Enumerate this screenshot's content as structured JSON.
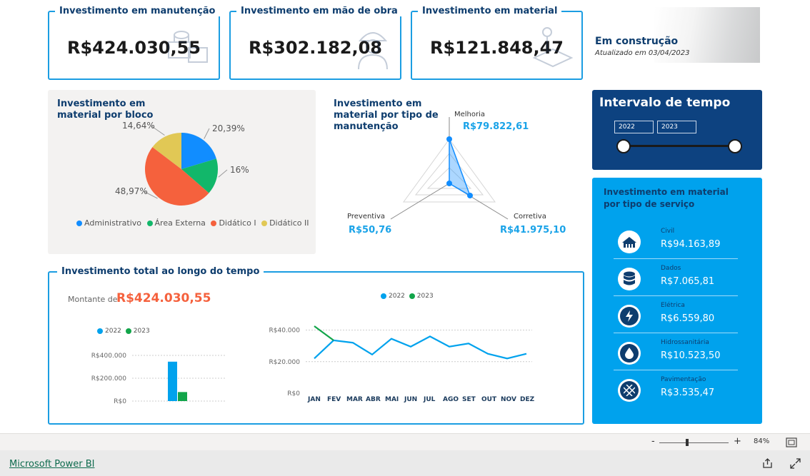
{
  "kpis": [
    {
      "title": "Investimento em manutenção",
      "value": "R$424.030,55",
      "icon": "building-materials-icon"
    },
    {
      "title": "Investimento em mão de obra",
      "value": "R$302.182,08",
      "icon": "construction-worker-icon"
    },
    {
      "title": "Investimento em material",
      "value": "R$121.848,47",
      "icon": "crane-materials-icon"
    }
  ],
  "header": {
    "status": "Em construção",
    "updated": "Atualizado em 03/04/2023"
  },
  "pie": {
    "title_line1": "Investimento em",
    "title_line2": "material por bloco",
    "labels": [
      "20,39%",
      "16%",
      "48,97%",
      "14,64%"
    ],
    "legend": [
      "Administrativo",
      "Área Externa",
      "Didático I",
      "Didático II"
    ],
    "colors": [
      "#118dff",
      "#12b76a",
      "#f5613d",
      "#e1c855"
    ]
  },
  "radar": {
    "title_line1": "Investimento em",
    "title_line2": "material por tipo de",
    "title_line3": "manutenção",
    "top_label": "Melhoria",
    "top_value": "R$79.822,61",
    "left_label": "Preventiva",
    "left_value": "R$50,76",
    "right_label": "Corretiva",
    "right_value": "R$41.975,10"
  },
  "timerange": {
    "title": "Intervalo de tempo",
    "from": "2022",
    "to": "2023"
  },
  "services": {
    "title_line1": "Investimento em material",
    "title_line2": "por tipo de serviço",
    "items": [
      {
        "name": "Civil",
        "value": "R$94.163,89",
        "icon": "building-icon"
      },
      {
        "name": "Dados",
        "value": "R$7.065,81",
        "icon": "database-icon"
      },
      {
        "name": "Elétrica",
        "value": "R$6.559,80",
        "icon": "lightning-icon"
      },
      {
        "name": "Hidrossanitária",
        "value": "R$10.523,50",
        "icon": "water-drop-icon"
      },
      {
        "name": "Pavimentação",
        "value": "R$3.535,47",
        "icon": "paving-icon"
      }
    ]
  },
  "total": {
    "title": "Investimento total ao longo do tempo",
    "amount_label": "Montante de",
    "amount_value": "R$424.030,55",
    "legend": [
      "2022",
      "2023"
    ],
    "bar_ticks": [
      "R$400.000",
      "R$200.000",
      "R$0"
    ],
    "line_ticks": [
      "R$40.000",
      "R$20.000",
      "R$0"
    ]
  },
  "chart_data": [
    {
      "type": "pie",
      "title": "Investimento em material por bloco",
      "categories": [
        "Administrativo",
        "Área Externa",
        "Didático I",
        "Didático II"
      ],
      "values": [
        20.39,
        16.0,
        48.97,
        14.64
      ]
    },
    {
      "type": "radar",
      "title": "Investimento em material por tipo de manutenção",
      "categories": [
        "Melhoria",
        "Corretiva",
        "Preventiva"
      ],
      "values": [
        79822.61,
        41975.1,
        50.76
      ]
    },
    {
      "type": "bar",
      "categories": [
        "2022",
        "2023"
      ],
      "values": [
        345000,
        79000
      ],
      "ylim": [
        0,
        400000
      ]
    },
    {
      "type": "line",
      "x": [
        "JAN",
        "FEV",
        "MAR",
        "ABR",
        "MAI",
        "JUN",
        "JUL",
        "AGO",
        "SET",
        "OUT",
        "NOV",
        "DEZ"
      ],
      "ylim": [
        0,
        40000
      ],
      "series": [
        {
          "name": "2022",
          "values": [
            22000,
            33500,
            32000,
            24500,
            34500,
            29500,
            36000,
            29500,
            31500,
            25000,
            22000,
            25000
          ]
        },
        {
          "name": "2023",
          "values": [
            42500,
            33500,
            null,
            null,
            null,
            null,
            null,
            null,
            null,
            null,
            null,
            null
          ]
        }
      ]
    }
  ],
  "footer": {
    "brand": "Microsoft Power BI",
    "zoom": "84%",
    "minus": "-",
    "plus": "+"
  }
}
